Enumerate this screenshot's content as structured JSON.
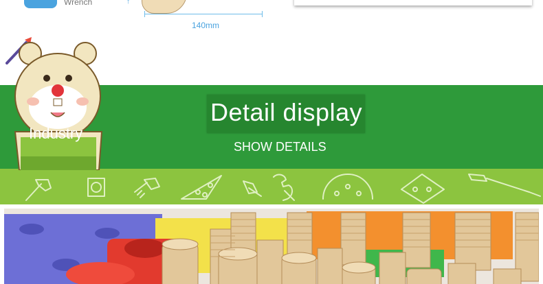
{
  "header": {
    "tool_label": "Wrench",
    "dimension_label": "140mm",
    "dimension_left_mark": "↑"
  },
  "banner": {
    "title": "Detail display",
    "subtitle": "SHOW DETAILS",
    "badge_label": "Industry"
  },
  "colors": {
    "green_banner": "#2e9a3a",
    "lime_strip": "#8cc43f",
    "accent_blue": "#4aa3df"
  },
  "icons": [
    "hammer-icon",
    "hex-nut-icon",
    "bolt-icon",
    "triangle-plate-icon",
    "screw-icon",
    "wrench-icon",
    "round-plate-icon",
    "diamond-plate-icon",
    "screwdriver-icon"
  ]
}
